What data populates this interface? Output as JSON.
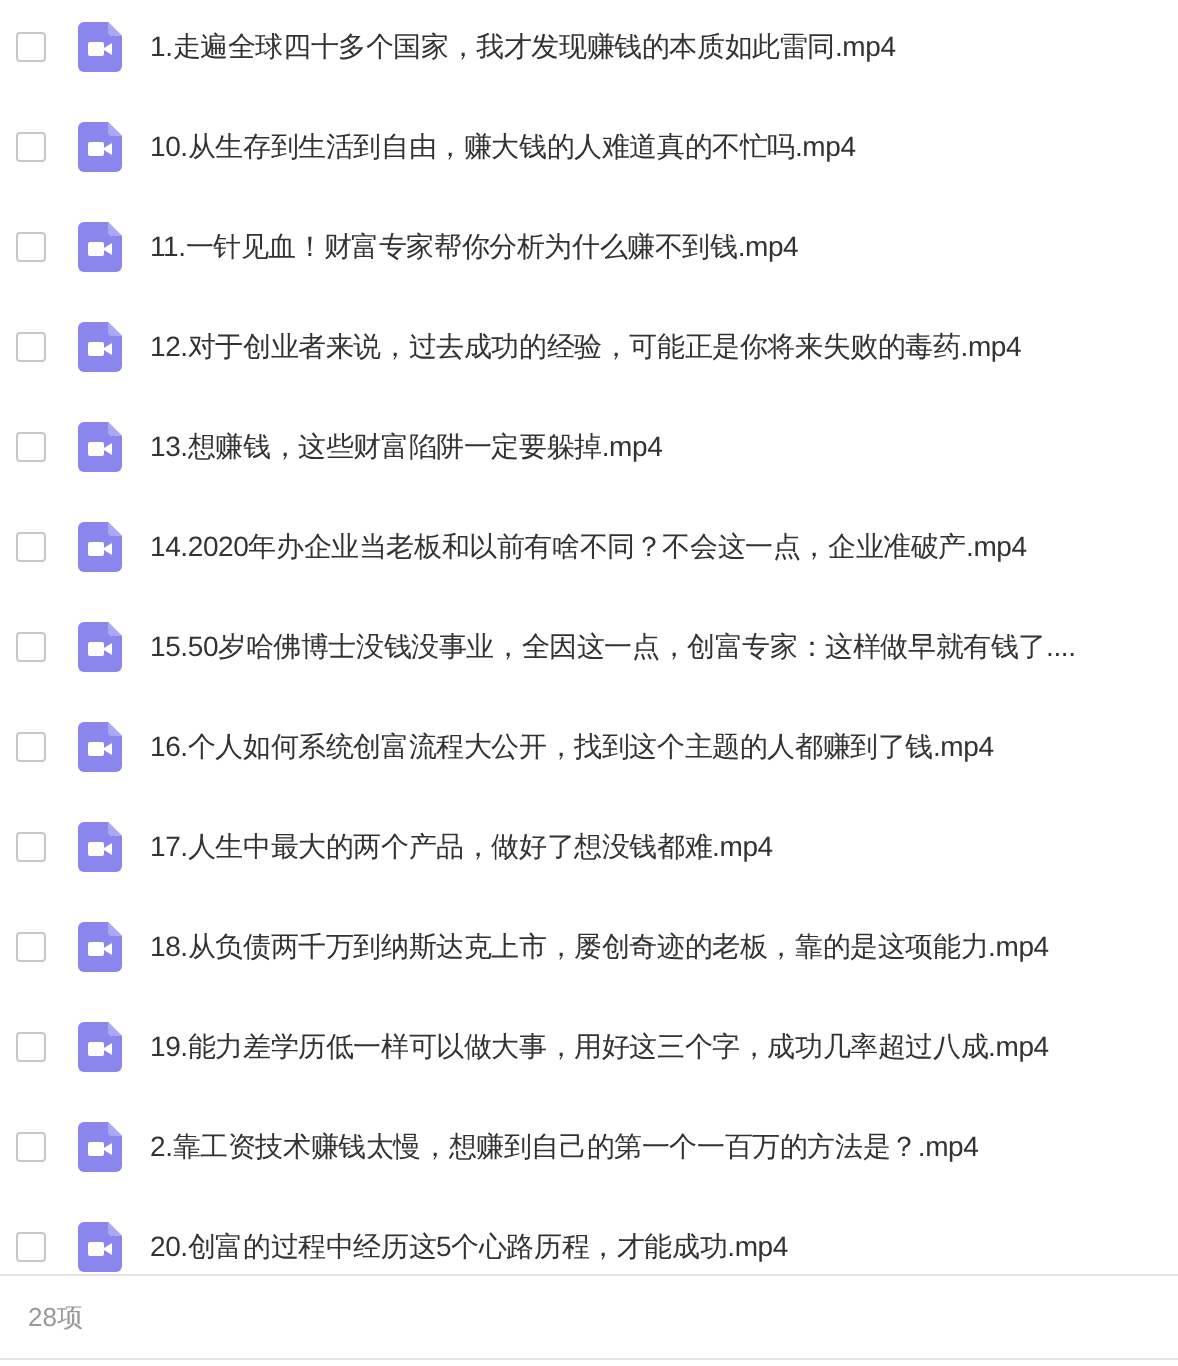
{
  "files": [
    {
      "name": "1.走遍全球四十多个国家，我才发现赚钱的本质如此雷同.mp4",
      "checked": false
    },
    {
      "name": "10.从生存到生活到自由，赚大钱的人难道真的不忙吗.mp4",
      "checked": false
    },
    {
      "name": "11.一针见血！财富专家帮你分析为什么赚不到钱.mp4",
      "checked": false
    },
    {
      "name": "12.对于创业者来说，过去成功的经验，可能正是你将来失败的毒药.mp4",
      "checked": false
    },
    {
      "name": "13.想赚钱，这些财富陷阱一定要躲掉.mp4",
      "checked": false
    },
    {
      "name": "14.2020年办企业当老板和以前有啥不同？不会这一点，企业准破产.mp4",
      "checked": false
    },
    {
      "name": "15.50岁哈佛博士没钱没事业，全因这一点，创富专家：这样做早就有钱了....",
      "checked": false
    },
    {
      "name": "16.个人如何系统创富流程大公开，找到这个主题的人都赚到了钱.mp4",
      "checked": false
    },
    {
      "name": "17.人生中最大的两个产品，做好了想没钱都难.mp4",
      "checked": false
    },
    {
      "name": "18.从负债两千万到纳斯达克上市，屡创奇迹的老板，靠的是这项能力.mp4",
      "checked": false
    },
    {
      "name": "19.能力差学历低一样可以做大事，用好这三个字，成功几率超过八成.mp4",
      "checked": false
    },
    {
      "name": "2.靠工资技术赚钱太慢，想赚到自己的第一个一百万的方法是？.mp4",
      "checked": false
    },
    {
      "name": "20.创富的过程中经历这5个心路历程，才能成功.mp4",
      "checked": false
    }
  ],
  "footer": {
    "count": "28项"
  }
}
